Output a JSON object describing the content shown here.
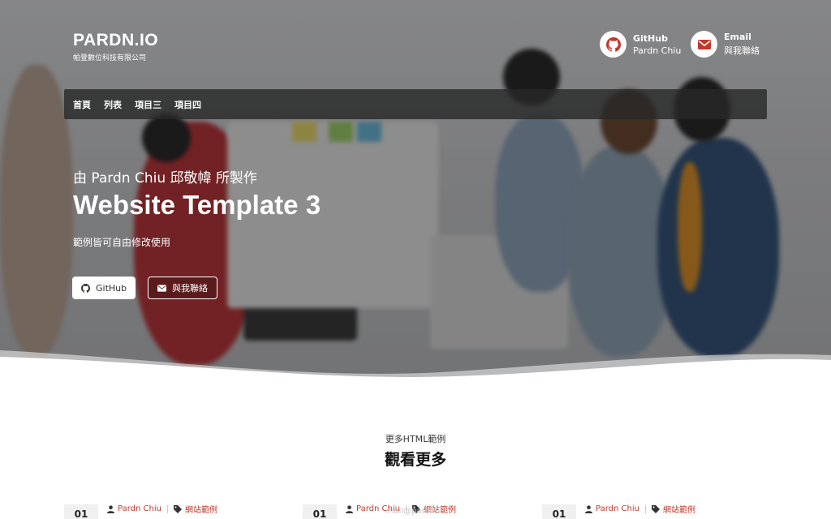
{
  "brand": {
    "title": "PARDN.IO",
    "subtitle": "帕登數位科技有限公司"
  },
  "contacts": [
    {
      "icon": "github-icon",
      "label": "GitHub",
      "value": "Pardn Chiu"
    },
    {
      "icon": "envelope-icon",
      "label": "Email",
      "value": "與我聯絡"
    }
  ],
  "nav": {
    "items": [
      "首頁",
      "列表",
      "項目三",
      "項目四"
    ]
  },
  "hero": {
    "by": "由 Pardn Chiu 邱敬幃 所製作",
    "title": "Website Template 3",
    "description": "範例皆可自由修改使用",
    "buttons": {
      "github": "GitHub",
      "contact": "與我聯絡"
    }
  },
  "section": {
    "subtitle": "更多HTML範例",
    "title": "觀看更多"
  },
  "cards": [
    {
      "number": "01",
      "author": "Pardn Chiu",
      "category": "網站範例"
    },
    {
      "number": "01",
      "author": "Pardn Chiu",
      "category": "網站範例"
    },
    {
      "number": "01",
      "author": "Pardn Chiu",
      "category": "網站範例"
    }
  ],
  "footer_ghost": "mail@pardn.io",
  "colors": {
    "accent": "#c0392b",
    "nav_bg": "#282828",
    "overlay": "#000000"
  }
}
